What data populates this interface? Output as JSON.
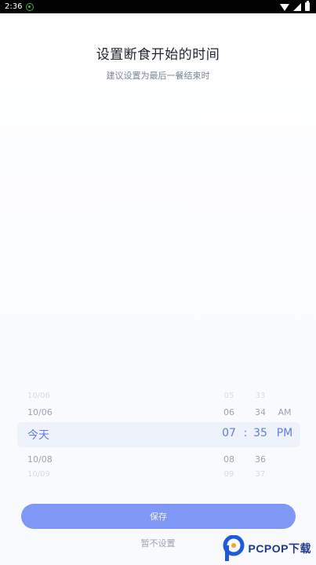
{
  "status_bar": {
    "time": "2:36",
    "icons": [
      "notification-icon",
      "wifi-icon",
      "signal-icon",
      "battery-icon"
    ]
  },
  "header": {
    "title": "设置断食开始的时间",
    "subtitle": "建议设置为最后一餐结束时"
  },
  "picker": {
    "date": {
      "far_top": "10/06",
      "near_top": "10/06",
      "selected": "今天",
      "near_bottom": "10/08",
      "far_bottom": "10/09"
    },
    "hour": {
      "far_top": "05",
      "near_top": "06",
      "selected": "07",
      "near_bottom": "08",
      "far_bottom": "09"
    },
    "separator": ":",
    "minute": {
      "far_top": "33",
      "near_top": "34",
      "selected": "35",
      "near_bottom": "36",
      "far_bottom": "37"
    },
    "ampm": {
      "near_top": "AM",
      "selected": "PM"
    }
  },
  "actions": {
    "save_label": "保存",
    "skip_label": "暂不设置"
  },
  "watermark": {
    "text": "PCPOP下载"
  },
  "colors": {
    "accent": "#7f97f5",
    "selected_text": "#5f7ee0",
    "highlight_bg": "#eef2fb"
  }
}
